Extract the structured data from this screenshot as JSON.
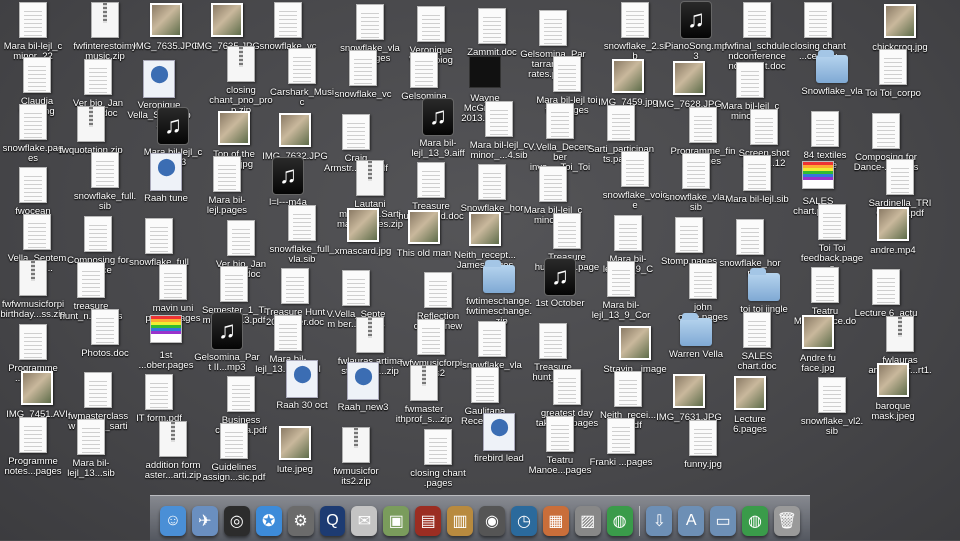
{
  "desktop": {
    "icons": [
      {
        "label": "Mara bil-lejl_c minor_22",
        "kind": "doc"
      },
      {
        "label": "fwfinterestoimy music.zip",
        "kind": "zip"
      },
      {
        "label": "IMG_7635.JPG",
        "kind": "image"
      },
      {
        "label": "IMG_7635.JPG",
        "kind": "image"
      },
      {
        "label": "snowflake_vc",
        "kind": "doc"
      },
      {
        "label": "snowflake_vla De pages",
        "kind": "doc"
      },
      {
        "label": "Veronique Vella_biog",
        "kind": "doc"
      },
      {
        "label": "Zammit.doc",
        "kind": "doc"
      },
      {
        "label": "Gelsomina_Partarranging rates.pages",
        "kind": "doc"
      },
      {
        "label": "snowflake_2.sib",
        "kind": "doc"
      },
      {
        "label": "PianoSong.mp3",
        "kind": "audio"
      },
      {
        "label": "fwfinal_schdule ndconference ndcon...It.doc",
        "kind": "doc"
      },
      {
        "label": "closing chant ...ce only",
        "kind": "doc"
      },
      {
        "label": "chickcroq.jpg",
        "kind": "image"
      },
      {
        "label": "Claudia wedding",
        "kind": "doc"
      },
      {
        "label": "Ver bio_Jan 2014.doc",
        "kind": "doc"
      },
      {
        "label": "Veronique Vella_S...la.mp3",
        "kind": "movie"
      },
      {
        "label": "closing chant_pno_prop.zip",
        "kind": "zip"
      },
      {
        "label": "Carshark_Music",
        "kind": "doc"
      },
      {
        "label": "snowflake_vc",
        "kind": "doc"
      },
      {
        "label": "Gelsomina",
        "kind": "doc"
      },
      {
        "label": "Wayne McGregor 2013.mpeg",
        "kind": "ted"
      },
      {
        "label": "Mara bil-lejl toi talk.pages",
        "kind": "doc"
      },
      {
        "label": "IMG_7459.jpg",
        "kind": "image"
      },
      {
        "label": "IMG_7628.JPG",
        "kind": "image"
      },
      {
        "label": "Mara bil-lejl_c minor.sib",
        "kind": "doc"
      },
      {
        "label": "Snowflake_vla",
        "kind": "folder"
      },
      {
        "label": "Toi Toi_corpo",
        "kind": "doc"
      },
      {
        "label": "snowflake.pages",
        "kind": "doc"
      },
      {
        "label": "fwquotation.zip",
        "kind": "zip"
      },
      {
        "label": "Mara bil-lejl_c 4.mp3",
        "kind": "audio"
      },
      {
        "label": "Top of the world.jpg",
        "kind": "image"
      },
      {
        "label": "IMG_7632.JPG",
        "kind": "image"
      },
      {
        "label": "Craig Armstr...ets.pdf",
        "kind": "doc"
      },
      {
        "label": "Mara bil-lejl_13_9.aiff",
        "kind": "audio"
      },
      {
        "label": "Mara bil-lejl_c minor_...4.sib",
        "kind": "doc"
      },
      {
        "label": "V.Vella_December invo..._Toi_Toi",
        "kind": "doc"
      },
      {
        "label": "Sarti_participants.pages",
        "kind": "doc"
      },
      {
        "label": "Programme_final.pages",
        "kind": "doc"
      },
      {
        "label": "Screen shot 2013-...12",
        "kind": "doc"
      },
      {
        "label": "84 textiles quote",
        "kind": "doc"
      },
      {
        "label": "Composing for Dance-...pages",
        "kind": "doc"
      },
      {
        "label": "fwocean",
        "kind": "doc"
      },
      {
        "label": "snowflake_full.sib",
        "kind": "doc"
      },
      {
        "label": "Raah tune",
        "kind": "movie"
      },
      {
        "label": "Mara bil-lejl.pages",
        "kind": "doc"
      },
      {
        "label": "l=l---m4a",
        "kind": "audio"
      },
      {
        "label": "Lautani masteru...Sarti master...ses.zip",
        "kind": "zip"
      },
      {
        "label": "Treasure hunt_u...ed.doc",
        "kind": "doc"
      },
      {
        "label": "Snowflake_horn",
        "kind": "doc"
      },
      {
        "label": "Mara bil-lejl_c minor.sib",
        "kind": "doc"
      },
      {
        "label": "snowflake_voice",
        "kind": "doc"
      },
      {
        "label": "snowflake_vla.sib",
        "kind": "doc"
      },
      {
        "label": "Mara bil-lejl.sib",
        "kind": "doc"
      },
      {
        "label": "SALES chart.pages",
        "kind": "chart"
      },
      {
        "label": "Sardinella_TRIO violin.pdf",
        "kind": "doc"
      },
      {
        "label": "Vella_Septem ...101...",
        "kind": "doc"
      },
      {
        "label": "Composing for Dance",
        "kind": "doc"
      },
      {
        "label": "snowflake_full",
        "kind": "doc"
      },
      {
        "label": "Ver bio_Jan 2014.doc",
        "kind": "doc"
      },
      {
        "label": "snowflake_full_vla.sib",
        "kind": "doc"
      },
      {
        "label": "xmascard.jpg",
        "kind": "image"
      },
      {
        "label": "This old man",
        "kind": "image"
      },
      {
        "label": "Neith_recept... James.pages",
        "kind": "image"
      },
      {
        "label": "Treasure hunt_new.pages",
        "kind": "doc"
      },
      {
        "label": "Mara bil-lejl_13_9_C",
        "kind": "doc"
      },
      {
        "label": "Stomp.pages",
        "kind": "doc"
      },
      {
        "label": "snowflake_horn",
        "kind": "doc"
      },
      {
        "label": "Toi Toi feedback.pages",
        "kind": "doc"
      },
      {
        "label": "andre.mp4",
        "kind": "image"
      },
      {
        "label": "fwfwmusicforpi birthday...ss.zip",
        "kind": "zip"
      },
      {
        "label": "treasure hunt_n...pages",
        "kind": "doc"
      },
      {
        "label": "mavin uni passw.pages",
        "kind": "doc"
      },
      {
        "label": "Semester_1_Ti metahi...13.pdf",
        "kind": "doc"
      },
      {
        "label": "Treasure Hunt 2014_Ver.doc",
        "kind": "doc"
      },
      {
        "label": "V.Vella_Septem ber...pages",
        "kind": "doc"
      },
      {
        "label": "Reflection dance_new",
        "kind": "doc"
      },
      {
        "label": "fwtimeschange.fwtimeschange...zip",
        "kind": "folder"
      },
      {
        "label": "1st October",
        "kind": "audio"
      },
      {
        "label": "Mara bil-lejl_13_9_Cor",
        "kind": "doc"
      },
      {
        "label": "john oboe.pages",
        "kind": "doc"
      },
      {
        "label": "toi toi jingle",
        "kind": "folder"
      },
      {
        "label": "Teatru Manoe...ice.doc",
        "kind": "doc"
      },
      {
        "label": "Lecture 6_actu",
        "kind": "doc"
      },
      {
        "label": "Programme ...ns.doc",
        "kind": "doc"
      },
      {
        "label": "Photos.doc",
        "kind": "doc"
      },
      {
        "label": "1st ...ober.pages",
        "kind": "chart"
      },
      {
        "label": "Gelsomina_Part II...mp3",
        "kind": "audio"
      },
      {
        "label": "Mara bil-lejl_13...4_9_Cl",
        "kind": "doc"
      },
      {
        "label": "fwlauras artima sterclass...zip",
        "kind": "zip"
      },
      {
        "label": "fwfwmusicforpian its2",
        "kind": "doc"
      },
      {
        "label": "snowflake_vla",
        "kind": "doc"
      },
      {
        "label": "Treasure hunt_new",
        "kind": "doc"
      },
      {
        "label": "Stravin...image",
        "kind": "image"
      },
      {
        "label": "Warren Vella",
        "kind": "folder"
      },
      {
        "label": "SALES chart.doc",
        "kind": "doc"
      },
      {
        "label": "Andre fu face.jpg",
        "kind": "image"
      },
      {
        "label": "fwlauras artimaster...rt1.zip",
        "kind": "zip"
      },
      {
        "label": "IMG_7451.AVI",
        "kind": "image"
      },
      {
        "label": "fwmasterclassw ithprof_sarti",
        "kind": "doc"
      },
      {
        "label": "IT form.pdf",
        "kind": "doc"
      },
      {
        "label": "Business card...lla.pdf",
        "kind": "doc"
      },
      {
        "label": "Raah 30 oct",
        "kind": "movie"
      },
      {
        "label": "Raah_new3",
        "kind": "movie"
      },
      {
        "label": "fwmaster ithprof_s...zip",
        "kind": "zip"
      },
      {
        "label": "Gaulitana Receipt.pdf",
        "kind": "doc"
      },
      {
        "label": "greatest day take th...pages",
        "kind": "doc"
      },
      {
        "label": "Neith_recei... sic.pdf",
        "kind": "doc"
      },
      {
        "label": "IMG_7631.JPG",
        "kind": "image"
      },
      {
        "label": "Lecture 6.pages",
        "kind": "image"
      },
      {
        "label": "snowflake_vl2.sib",
        "kind": "doc"
      },
      {
        "label": "baroque mask.jpeg",
        "kind": "image"
      },
      {
        "label": "Programme notes...pages",
        "kind": "doc"
      },
      {
        "label": "Mara bil-lejl_13...sib",
        "kind": "doc"
      },
      {
        "label": "addition form aster...arti.zip",
        "kind": "zip"
      },
      {
        "label": "Guidelines assign...sic.pdf",
        "kind": "doc"
      },
      {
        "label": "lute.jpeg",
        "kind": "image"
      },
      {
        "label": "fwmusicfor its2.zip",
        "kind": "zip"
      },
      {
        "label": "closing chant .pages",
        "kind": "doc"
      },
      {
        "label": "firebird lead",
        "kind": "movie"
      },
      {
        "label": "Teatru Manoe...pages",
        "kind": "doc"
      },
      {
        "label": "Franki ...pages",
        "kind": "doc"
      },
      {
        "label": "funny.jpg",
        "kind": "doc"
      }
    ]
  },
  "dock": {
    "items": [
      {
        "name": "finder",
        "glyph": "☺",
        "color": "#4a8fd6"
      },
      {
        "name": "preview",
        "glyph": "✈",
        "color": "#6a8fc0"
      },
      {
        "name": "dashboard",
        "glyph": "◎",
        "color": "#2c2c2c"
      },
      {
        "name": "safari",
        "glyph": "✪",
        "color": "#3d8bd9"
      },
      {
        "name": "system-preferences",
        "glyph": "⚙",
        "color": "#6b6b6b"
      },
      {
        "name": "quicktime",
        "glyph": "Q",
        "color": "#1d3b72"
      },
      {
        "name": "mail",
        "glyph": "✉",
        "color": "#c4c4c4"
      },
      {
        "name": "iphoto",
        "glyph": "▣",
        "color": "#7a9c5c"
      },
      {
        "name": "photo-booth",
        "glyph": "▤",
        "color": "#9b2d22"
      },
      {
        "name": "preview-viewer",
        "glyph": "▥",
        "color": "#b88a3f"
      },
      {
        "name": "camera",
        "glyph": "◉",
        "color": "#555"
      },
      {
        "name": "time-machine",
        "glyph": "◷",
        "color": "#2b6a9c"
      },
      {
        "name": "ical",
        "glyph": "▦",
        "color": "#c96e3a"
      },
      {
        "name": "photo-viewer",
        "glyph": "▨",
        "color": "#888"
      },
      {
        "name": "chrome",
        "glyph": "◍",
        "color": "#3a9b4a"
      }
    ],
    "stack_items": [
      {
        "name": "downloads-stack",
        "glyph": "⇩",
        "color": "#6d8fb5"
      },
      {
        "name": "applications-stack",
        "glyph": "A",
        "color": "#6d8fb5"
      },
      {
        "name": "documents-stack",
        "glyph": "▭",
        "color": "#6d8fb5"
      },
      {
        "name": "chrome-stack",
        "glyph": "◍",
        "color": "#3a9b4a"
      },
      {
        "name": "trash",
        "glyph": "🗑",
        "color": "#9a9a9a"
      }
    ]
  }
}
